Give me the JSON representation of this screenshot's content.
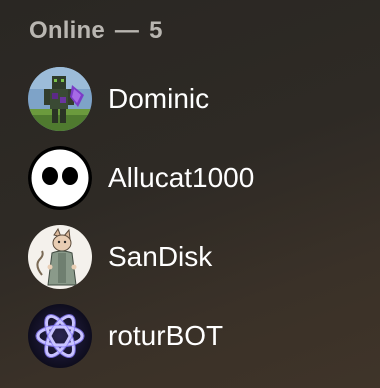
{
  "members_list": {
    "section": {
      "status": "Online",
      "separator": "—",
      "count": "5"
    },
    "members": [
      {
        "name": "Dominic",
        "avatar_icon": "minecraft-skin-avatar-icon"
      },
      {
        "name": "Allucat1000",
        "avatar_icon": "cat-eyes-avatar-icon"
      },
      {
        "name": "SanDisk",
        "avatar_icon": "character-drawing-avatar-icon"
      },
      {
        "name": "roturBOT",
        "avatar_icon": "atom-logo-avatar-icon"
      }
    ]
  }
}
